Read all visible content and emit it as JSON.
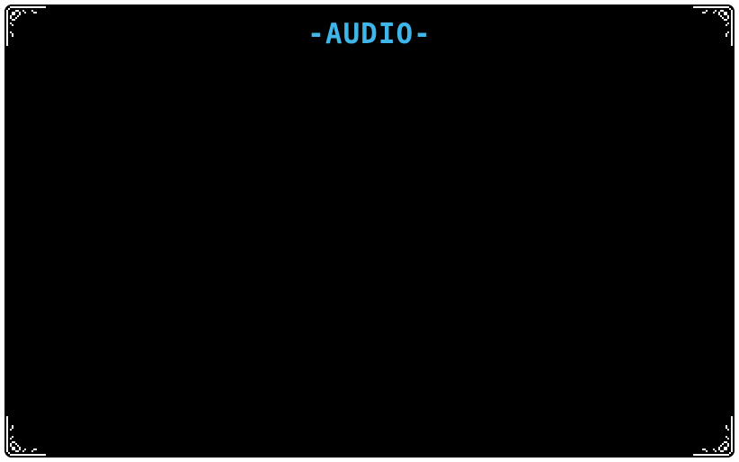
{
  "screen": {
    "title": "-AUDIO-",
    "title_color": "#3fb6ea",
    "background_color": "#000000",
    "frame_color": "#ffffff"
  },
  "ornaments": {
    "icon": "pixel-flourish-corner-icon"
  }
}
